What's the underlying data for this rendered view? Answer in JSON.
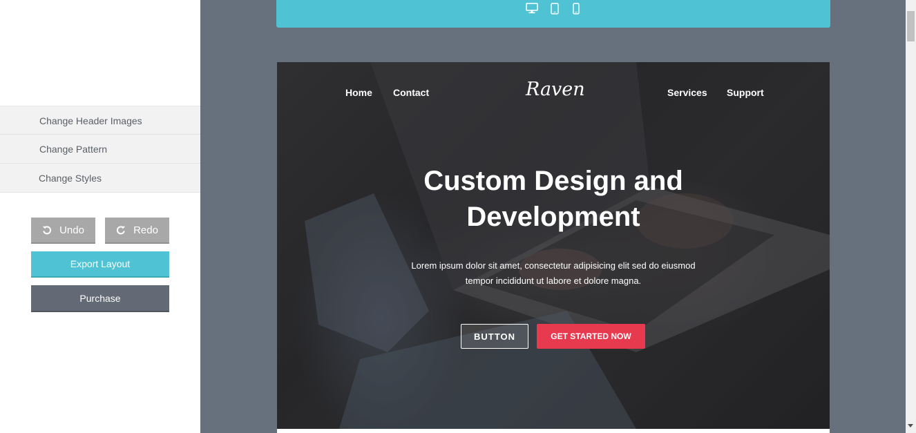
{
  "sidebar": {
    "menu": [
      {
        "label": "Change Header Images"
      },
      {
        "label": "Change Pattern"
      },
      {
        "label": "Change Styles"
      }
    ],
    "undo_label": "Undo",
    "redo_label": "Redo",
    "export_label": "Export Layout",
    "purchase_label": "Purchase"
  },
  "device_bar": {
    "icons": [
      "desktop-icon",
      "tablet-icon",
      "phone-icon"
    ],
    "color": "#4fc3d3"
  },
  "hero": {
    "nav": {
      "home": "Home",
      "contact": "Contact",
      "services": "Services",
      "support": "Support"
    },
    "logo": "Raven",
    "headline_line1": "Custom Design and",
    "headline_line2": "Development",
    "subtext_line1": "Lorem ipsum dolor sit amet, consectetur adipisicing elit sed do eiusmod",
    "subtext_line2": "tempor incididunt ut labore et dolore magna.",
    "button_label": "BUTTON",
    "cta_label": "GET STARTED NOW",
    "cta_color": "#e83a4f"
  },
  "colors": {
    "accent": "#4fc3d3",
    "preview_bg": "#67717d",
    "purchase_bg": "#636a75",
    "undo_redo_bg": "#a8a8a8"
  }
}
